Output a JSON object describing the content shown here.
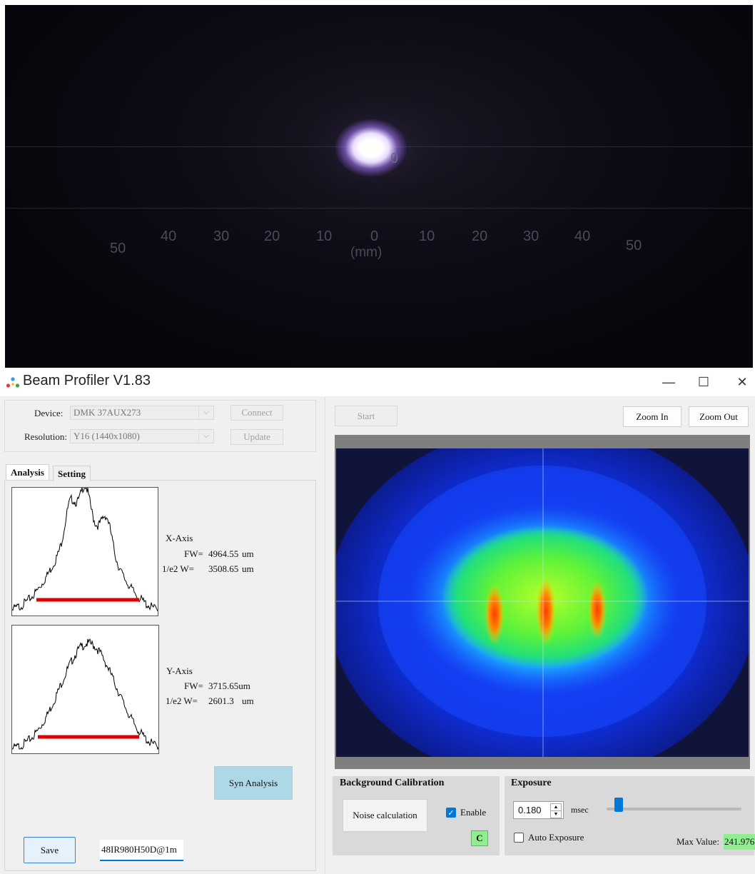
{
  "photo": {
    "spot_label": "0",
    "ruler_numbers": [
      {
        "text": "50"
      },
      {
        "text": "40"
      },
      {
        "text": "30"
      },
      {
        "text": "20"
      },
      {
        "text": "10"
      },
      {
        "text": "0"
      },
      {
        "text": "10"
      },
      {
        "text": "20"
      },
      {
        "text": "30"
      },
      {
        "text": "40"
      },
      {
        "text": "50"
      }
    ],
    "ruler_unit": "(mm)"
  },
  "window": {
    "title": "Beam Profiler V1.83",
    "minimize": "—",
    "maximize": "☐",
    "close": "✕"
  },
  "device": {
    "device_label": "Device:",
    "device_value": "DMK 37AUX273",
    "resolution_label": "Resolution:",
    "resolution_value": "Y16 (1440x1080)",
    "connect_label": "Connect",
    "update_label": "Update"
  },
  "tabs": [
    {
      "label": "Analysis",
      "active": true
    },
    {
      "label": "Setting",
      "active": false
    }
  ],
  "analysis": {
    "x_axis": {
      "title": "X-Axis",
      "fw_label": "FW=",
      "fw_value": "4964.55",
      "fw_unit": "um",
      "e2_label": "1/e2 W=",
      "e2_value": "3508.65",
      "e2_unit": "um"
    },
    "y_axis": {
      "title": "Y-Axis",
      "fw_label": "FW=",
      "fw_value": "3715.65um",
      "e2_label": "1/e2 W=",
      "e2_value": "2601.3",
      "e2_unit": "um"
    },
    "syn_label": "Syn Analysis",
    "save_label": "Save",
    "filename_value": "48IR980H50D@1m"
  },
  "controls": {
    "start_label": "Start",
    "zoom_in_label": "Zoom In",
    "zoom_out_label": "Zoom Out"
  },
  "background": {
    "title": "Background Calibration",
    "noise_label": "Noise calculation",
    "enable_label": "Enable",
    "enable_checked": true,
    "c_label": "C"
  },
  "exposure": {
    "title": "Exposure",
    "value": "0.180",
    "unit": "msec",
    "auto_label": "Auto Exposure",
    "auto_checked": false,
    "slider_level": 0.06,
    "max_label": "Max Value:",
    "max_value": "241.976"
  },
  "colors": {
    "accent": "#0078d7",
    "red_line": "#e00000",
    "syn_button": "#add8e6",
    "c_button": "#90ee90",
    "max_value_bg": "#90ee90"
  }
}
